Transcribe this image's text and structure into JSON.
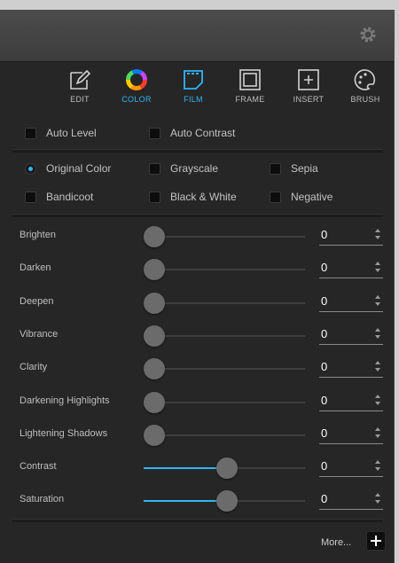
{
  "toolbar": {
    "tools": [
      {
        "id": "edit",
        "label": "EDIT",
        "icon": "edit-icon"
      },
      {
        "id": "color",
        "label": "COLOR",
        "icon": "color-wheel-icon"
      },
      {
        "id": "film",
        "label": "FILM",
        "icon": "film-icon"
      },
      {
        "id": "frame",
        "label": "FRAME",
        "icon": "frame-icon"
      },
      {
        "id": "insert",
        "label": "INSERT",
        "icon": "insert-icon"
      },
      {
        "id": "brush",
        "label": "BRUSH",
        "icon": "brush-icon"
      }
    ],
    "active": "film"
  },
  "auto": {
    "auto_level": "Auto Level",
    "auto_contrast": "Auto Contrast"
  },
  "filters": {
    "selected": "Original Color",
    "options": [
      "Original Color",
      "Grayscale",
      "Sepia",
      "Bandicoot",
      "Black & White",
      "Negative"
    ]
  },
  "adjustments": [
    {
      "label": "Brighten",
      "value": "0",
      "level": 0
    },
    {
      "label": "Darken",
      "value": "0",
      "level": 0
    },
    {
      "label": "Deepen",
      "value": "0",
      "level": 0
    },
    {
      "label": "Vibrance",
      "value": "0",
      "level": 0
    },
    {
      "label": "Clarity",
      "value": "0",
      "level": 0
    },
    {
      "label": "Darkening Highlights",
      "value": "0",
      "level": 0
    },
    {
      "label": "Lightening Shadows",
      "value": "0",
      "level": 0
    },
    {
      "label": "Contrast",
      "value": "0",
      "level": 0.5
    },
    {
      "label": "Saturation",
      "value": "0",
      "level": 0.5
    }
  ],
  "footer": {
    "more_label": "More..."
  },
  "colors": {
    "accent": "#33b4f2",
    "panel": "#262626",
    "titlebar": "#444444"
  }
}
